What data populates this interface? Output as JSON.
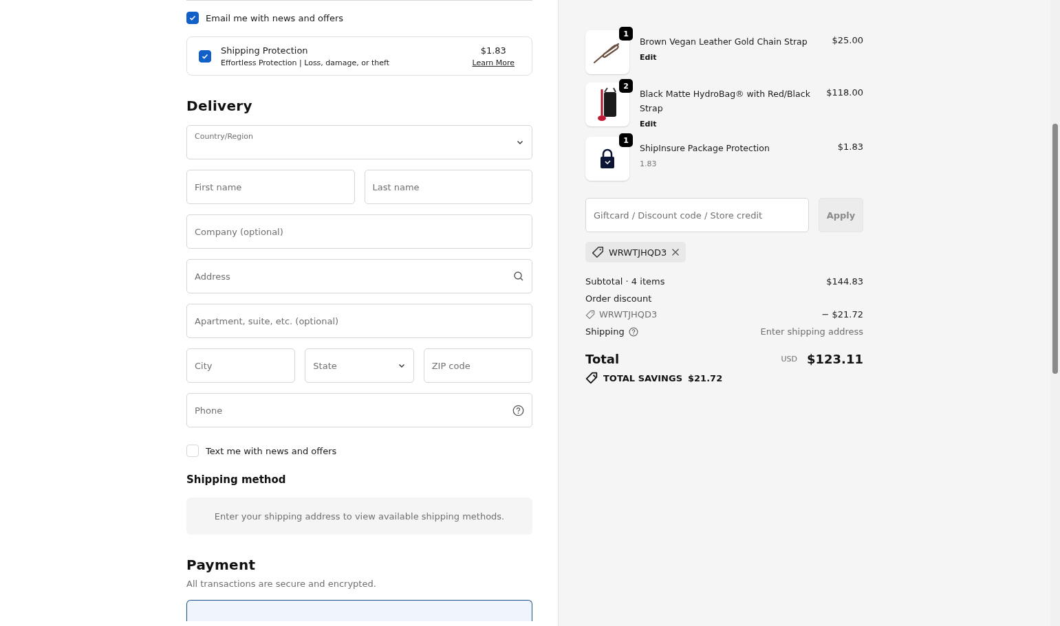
{
  "contact": {
    "email_news": {
      "label": "Email me with news and offers",
      "checked": true
    },
    "protection": {
      "title": "Shipping Protection",
      "subtitle": "Effortless Protection | Loss, damage, or theft",
      "price": "$1.83",
      "link": "Learn More",
      "checked": true
    }
  },
  "delivery": {
    "title": "Delivery",
    "rows": [
      [
        {
          "kind": "select",
          "label": "Country/Region"
        }
      ],
      [
        {
          "kind": "input",
          "placeholder": "First name"
        },
        {
          "kind": "input",
          "placeholder": "Last name"
        }
      ],
      [
        {
          "kind": "input",
          "placeholder": "Company (optional)"
        }
      ],
      [
        {
          "kind": "search",
          "placeholder": "Address"
        }
      ],
      [
        {
          "kind": "input",
          "placeholder": "Apartment, suite, etc. (optional)"
        }
      ],
      [
        {
          "kind": "input",
          "placeholder": "City"
        },
        {
          "kind": "dropdown",
          "placeholder": "State"
        },
        {
          "kind": "input",
          "placeholder": "ZIP code"
        }
      ],
      [
        {
          "kind": "help",
          "placeholder": "Phone"
        }
      ]
    ],
    "text_news": {
      "label": "Text me with news and offers",
      "checked": false
    }
  },
  "shipping_method": {
    "title": "Shipping method",
    "message": "Enter your shipping address to view available shipping methods."
  },
  "payment": {
    "title": "Payment",
    "subtitle": "All transactions are secure and encrypted."
  },
  "summary": {
    "items": [
      {
        "kind": "strap",
        "quantity": "1",
        "name": "Brown Vegan Leather Gold Chain Strap",
        "price": "$25.00",
        "edit": "Edit"
      },
      {
        "kind": "bag",
        "quantity": "2",
        "name": "Black Matte HydroBag® with Red/Black Strap",
        "price": "$118.00",
        "edit": "Edit"
      },
      {
        "kind": "lock",
        "quantity": "1",
        "name": "ShipInsure Package Protection",
        "price": "$1.83",
        "note": "1.83"
      }
    ],
    "discount_field": {
      "placeholder": "Giftcard / Discount code / Store credit"
    },
    "apply_button": "Apply",
    "applied_code": "WRWTJHQD3",
    "subtotal": {
      "label": "Subtotal · 4 items",
      "value": "$144.83"
    },
    "order_discount": {
      "label": "Order discount",
      "code": "WRWTJHQD3",
      "value": "− $21.72"
    },
    "shipping": {
      "label": "Shipping",
      "value": "Enter shipping address"
    },
    "total": {
      "label": "Total",
      "currency": "USD",
      "value": "$123.11"
    },
    "savings": {
      "label": "TOTAL SAVINGS",
      "value": "$21.72"
    }
  }
}
